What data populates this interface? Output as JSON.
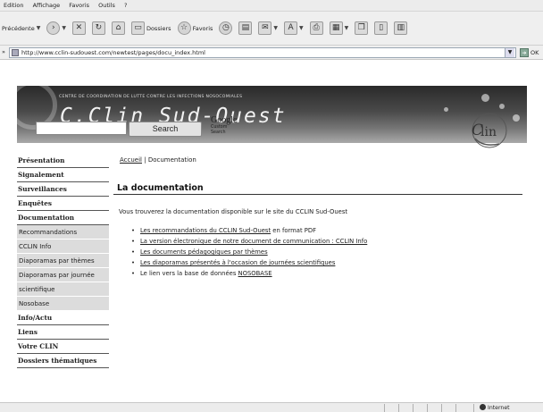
{
  "browser": {
    "menu": [
      "Edition",
      "Affichage",
      "Favoris",
      "Outils",
      "?"
    ],
    "toolbar": {
      "back_label": "Précédente",
      "folders_label": "Dossiers",
      "favorites_label": "Favoris"
    },
    "address": {
      "url": "http://www.cclin-sudouest.com/newtest/pages/docu_index.html",
      "go_label": "OK"
    },
    "status": {
      "zone_label": "Internet"
    }
  },
  "site": {
    "org_line": "CENTRE DE COORDINATION DE LUTTE CONTRE LES INFECTIONS NOSOCOMIALES",
    "title": "C.Clin Sud-Ouest",
    "search": {
      "input_value": "",
      "button_label": "Search",
      "google_label": "Google",
      "google_sub": "Custom Search"
    }
  },
  "sidebar": {
    "items": [
      {
        "label": "Présentation",
        "type": "main"
      },
      {
        "label": "Signalement",
        "type": "main"
      },
      {
        "label": "Surveillances",
        "type": "main"
      },
      {
        "label": "Enquêtes",
        "type": "main"
      },
      {
        "label": "Documentation",
        "type": "main"
      },
      {
        "label": "Recommandations",
        "type": "sub"
      },
      {
        "label": "CCLIN Info",
        "type": "sub"
      },
      {
        "label": "Diaporamas par thèmes",
        "type": "sub"
      },
      {
        "label": "Diaporamas par journée",
        "type": "sub"
      },
      {
        "label": "scientifique",
        "type": "sub"
      },
      {
        "label": "Nosobase",
        "type": "sub"
      },
      {
        "label": "Info/Actu",
        "type": "main"
      },
      {
        "label": "Liens",
        "type": "main"
      },
      {
        "label": "Votre CLIN",
        "type": "main"
      },
      {
        "label": "Dossiers thématiques",
        "type": "main"
      }
    ]
  },
  "main": {
    "breadcrumb": {
      "home": "Accueil",
      "separator": "|",
      "current": "Documentation"
    },
    "title": "La documentation",
    "intro": "Vous trouverez la documentation disponible sur le site du CCLIN Sud-Ouest",
    "links": [
      {
        "link": "Les recommandations du CCLIN Sud-Ouest",
        "suffix": " en format PDF"
      },
      {
        "link": "La version électronique de notre document de communication : CCLIN Info",
        "suffix": ""
      },
      {
        "link": "Les documents pédagogiques par thèmes",
        "suffix": ""
      },
      {
        "link": "Les diaporamas présentés à l'occasion de journées scientifiques",
        "suffix": ""
      },
      {
        "prefix": "Le lien vers la base de données ",
        "link": "NOSOBASE",
        "suffix": ""
      }
    ]
  }
}
